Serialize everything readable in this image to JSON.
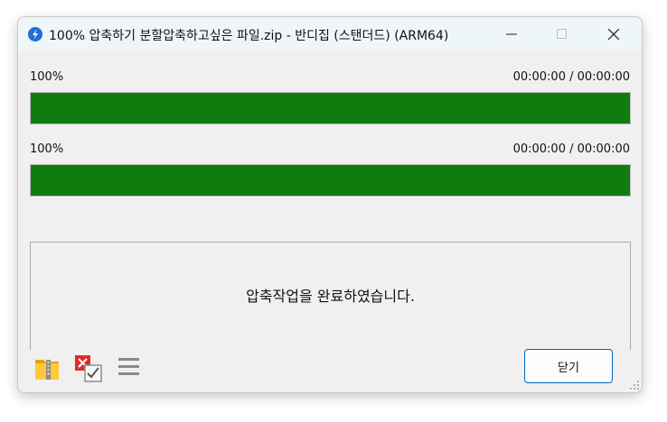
{
  "window": {
    "title": "100% 압축하기 분할압축하고싶은 파일.zip - 반디집 (스탠더드) (ARM64)"
  },
  "progress": [
    {
      "percent_label": "100%",
      "time": "00:00:00 / 00:00:00",
      "value": 100
    },
    {
      "percent_label": "100%",
      "time": "00:00:00 / 00:00:00",
      "value": 100
    }
  ],
  "message": "압축작업을 완료하였습니다.",
  "buttons": {
    "close_label": "닫기"
  },
  "icons": {
    "app": "bandizip-icon",
    "open_folder": "open-folder-icon",
    "delete_check": "delete-after-icon",
    "menu": "hamburger-menu-icon"
  },
  "colors": {
    "progress_fill": "#107c10",
    "accent": "#0067c0"
  }
}
